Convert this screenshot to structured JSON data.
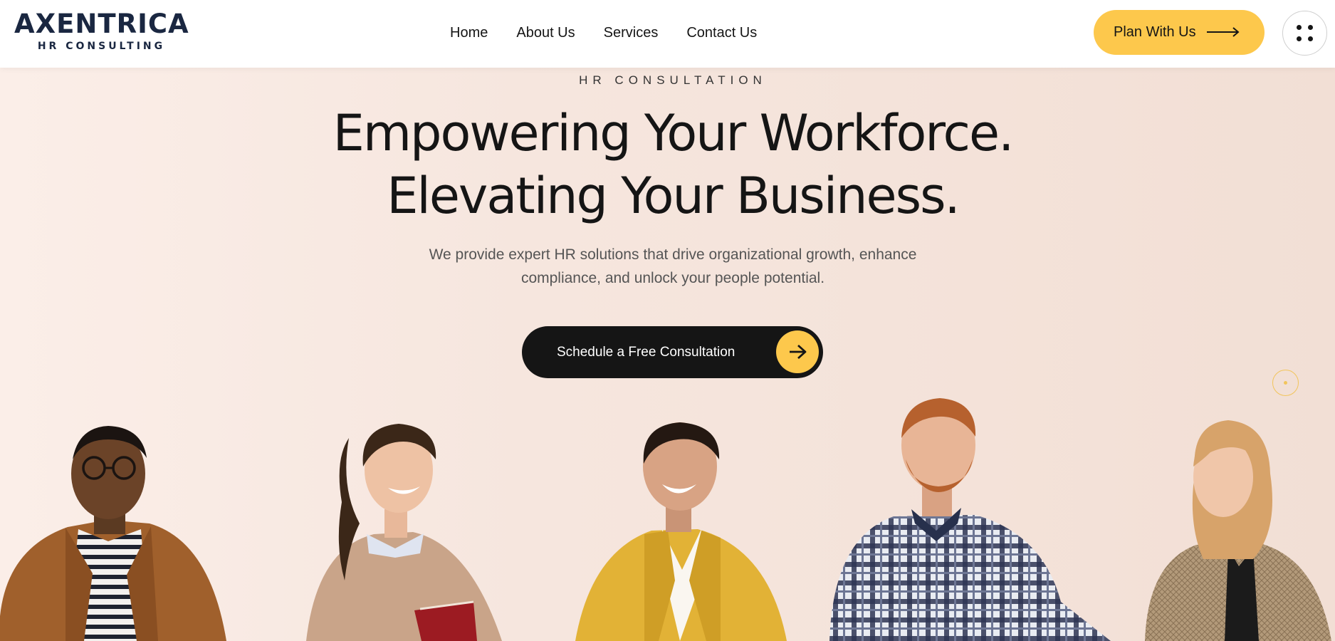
{
  "brand": {
    "name": "AXENTRICA",
    "tagline": "HR CONSULTING",
    "color": "#1a2741"
  },
  "nav": {
    "items": [
      {
        "label": "Home"
      },
      {
        "label": "About Us"
      },
      {
        "label": "Services"
      },
      {
        "label": "Contact Us"
      }
    ]
  },
  "header": {
    "plan_label": "Plan With Us",
    "plan_icon": "arrow-right-icon",
    "menu_icon": "grid-dots-icon"
  },
  "hero": {
    "eyebrow": "HR CONSULTATION",
    "headline_line1": "Empowering Your Workforce.",
    "headline_line2": "Elevating Your Business.",
    "subtext_line1": "We provide expert HR solutions that drive organizational growth, enhance",
    "subtext_line2": "compliance, and unlock your people potential.",
    "cta_label": "Schedule a Free Consultation",
    "cta_icon": "arrow-right-icon"
  },
  "colors": {
    "accent": "#fdc84c",
    "dark": "#151515",
    "background": "#f5e7df"
  }
}
